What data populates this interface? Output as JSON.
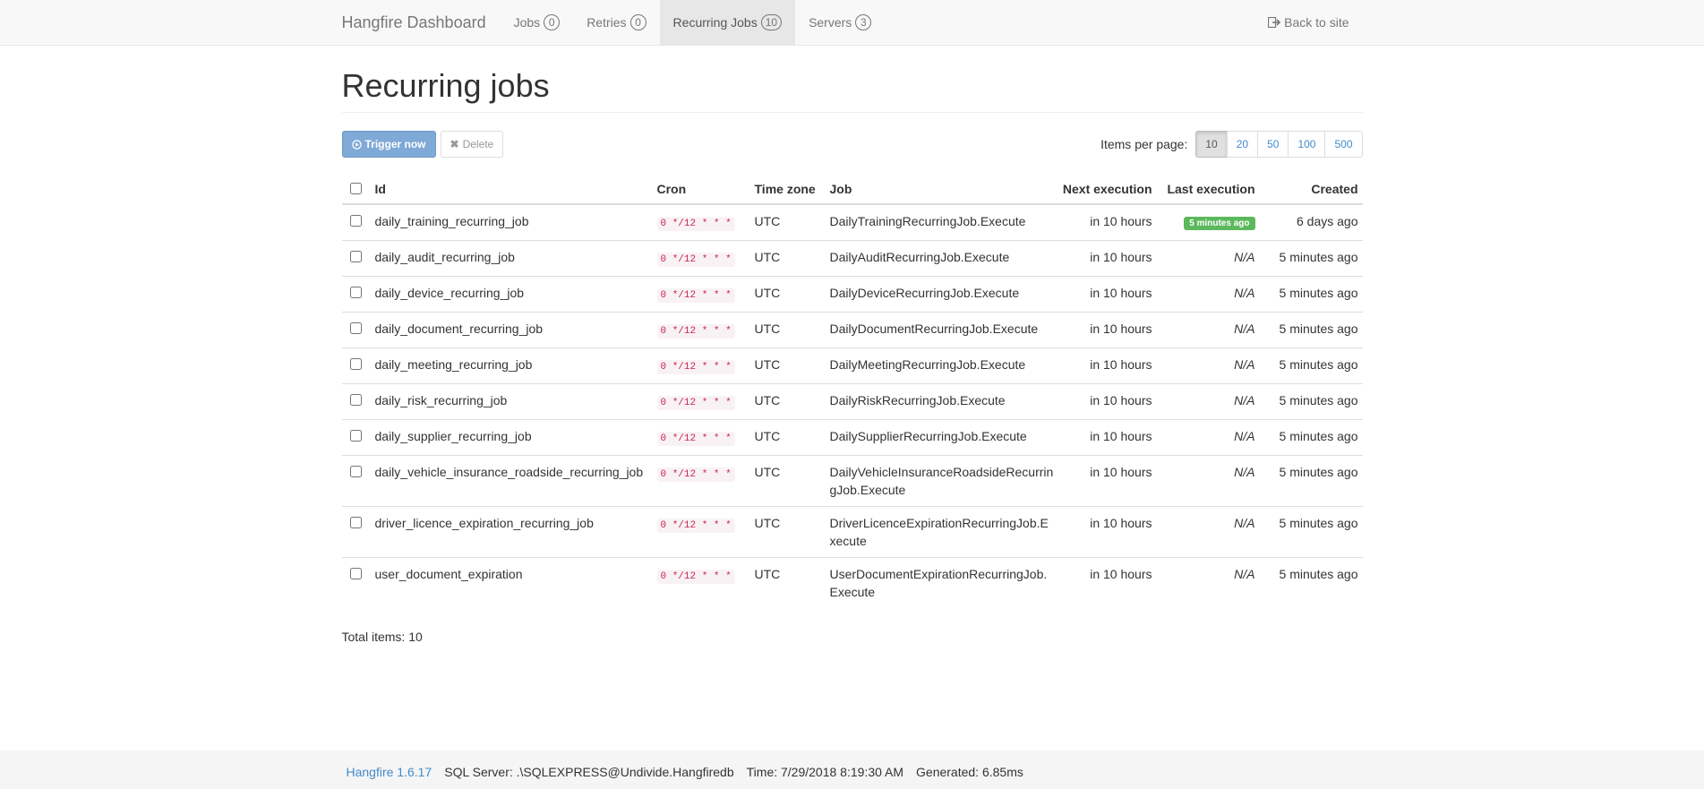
{
  "nav": {
    "brand": "Hangfire Dashboard",
    "items": [
      {
        "label": "Jobs",
        "count": "0"
      },
      {
        "label": "Retries",
        "count": "0"
      },
      {
        "label": "Recurring Jobs",
        "count": "10"
      },
      {
        "label": "Servers",
        "count": "3"
      }
    ],
    "back": "Back to site"
  },
  "page": {
    "title": "Recurring jobs",
    "trigger_label": "Trigger now",
    "delete_label": "Delete",
    "per_page_label": "Items per page:",
    "per_page_options": [
      "10",
      "20",
      "50",
      "100",
      "500"
    ],
    "total": "Total items: 10"
  },
  "table": {
    "headers": {
      "id": "Id",
      "cron": "Cron",
      "tz": "Time zone",
      "job": "Job",
      "next": "Next execution",
      "last": "Last execution",
      "created": "Created"
    },
    "rows": [
      {
        "id": "daily_training_recurring_job",
        "cron": "0 */12 * * *",
        "tz": "UTC",
        "job": "DailyTrainingRecurringJob.Execute",
        "next": "in 10 hours",
        "last": "5 minutes ago",
        "created": "6 days ago"
      },
      {
        "id": "daily_audit_recurring_job",
        "cron": "0 */12 * * *",
        "tz": "UTC",
        "job": "DailyAuditRecurringJob.Execute",
        "next": "in 10 hours",
        "last": "N/A",
        "created": "5 minutes ago"
      },
      {
        "id": "daily_device_recurring_job",
        "cron": "0 */12 * * *",
        "tz": "UTC",
        "job": "DailyDeviceRecurringJob.Execute",
        "next": "in 10 hours",
        "last": "N/A",
        "created": "5 minutes ago"
      },
      {
        "id": "daily_document_recurring_job",
        "cron": "0 */12 * * *",
        "tz": "UTC",
        "job": "DailyDocumentRecurringJob.Execute",
        "next": "in 10 hours",
        "last": "N/A",
        "created": "5 minutes ago"
      },
      {
        "id": "daily_meeting_recurring_job",
        "cron": "0 */12 * * *",
        "tz": "UTC",
        "job": "DailyMeetingRecurringJob.Execute",
        "next": "in 10 hours",
        "last": "N/A",
        "created": "5 minutes ago"
      },
      {
        "id": "daily_risk_recurring_job",
        "cron": "0 */12 * * *",
        "tz": "UTC",
        "job": "DailyRiskRecurringJob.Execute",
        "next": "in 10 hours",
        "last": "N/A",
        "created": "5 minutes ago"
      },
      {
        "id": "daily_supplier_recurring_job",
        "cron": "0 */12 * * *",
        "tz": "UTC",
        "job": "DailySupplierRecurringJob.Execute",
        "next": "in 10 hours",
        "last": "N/A",
        "created": "5 minutes ago"
      },
      {
        "id": "daily_vehicle_insurance_roadside_recurring_job",
        "cron": "0 */12 * * *",
        "tz": "UTC",
        "job": "DailyVehicleInsuranceRoadsideRecurringJob.Execute",
        "next": "in 10 hours",
        "last": "N/A",
        "created": "5 minutes ago"
      },
      {
        "id": "driver_licence_expiration_recurring_job",
        "cron": "0 */12 * * *",
        "tz": "UTC",
        "job": "DriverLicenceExpirationRecurringJob.Execute",
        "next": "in 10 hours",
        "last": "N/A",
        "created": "5 minutes ago"
      },
      {
        "id": "user_document_expiration",
        "cron": "0 */12 * * *",
        "tz": "UTC",
        "job": "UserDocumentExpirationRecurringJob.Execute",
        "next": "in 10 hours",
        "last": "N/A",
        "created": "5 minutes ago"
      }
    ]
  },
  "footer": {
    "version": "Hangfire 1.6.17",
    "server": "SQL Server: .\\SQLEXPRESS@Undivide.Hangfiredb",
    "time": "Time: 7/29/2018 8:19:30 AM",
    "generated": "Generated: 6.85ms"
  }
}
